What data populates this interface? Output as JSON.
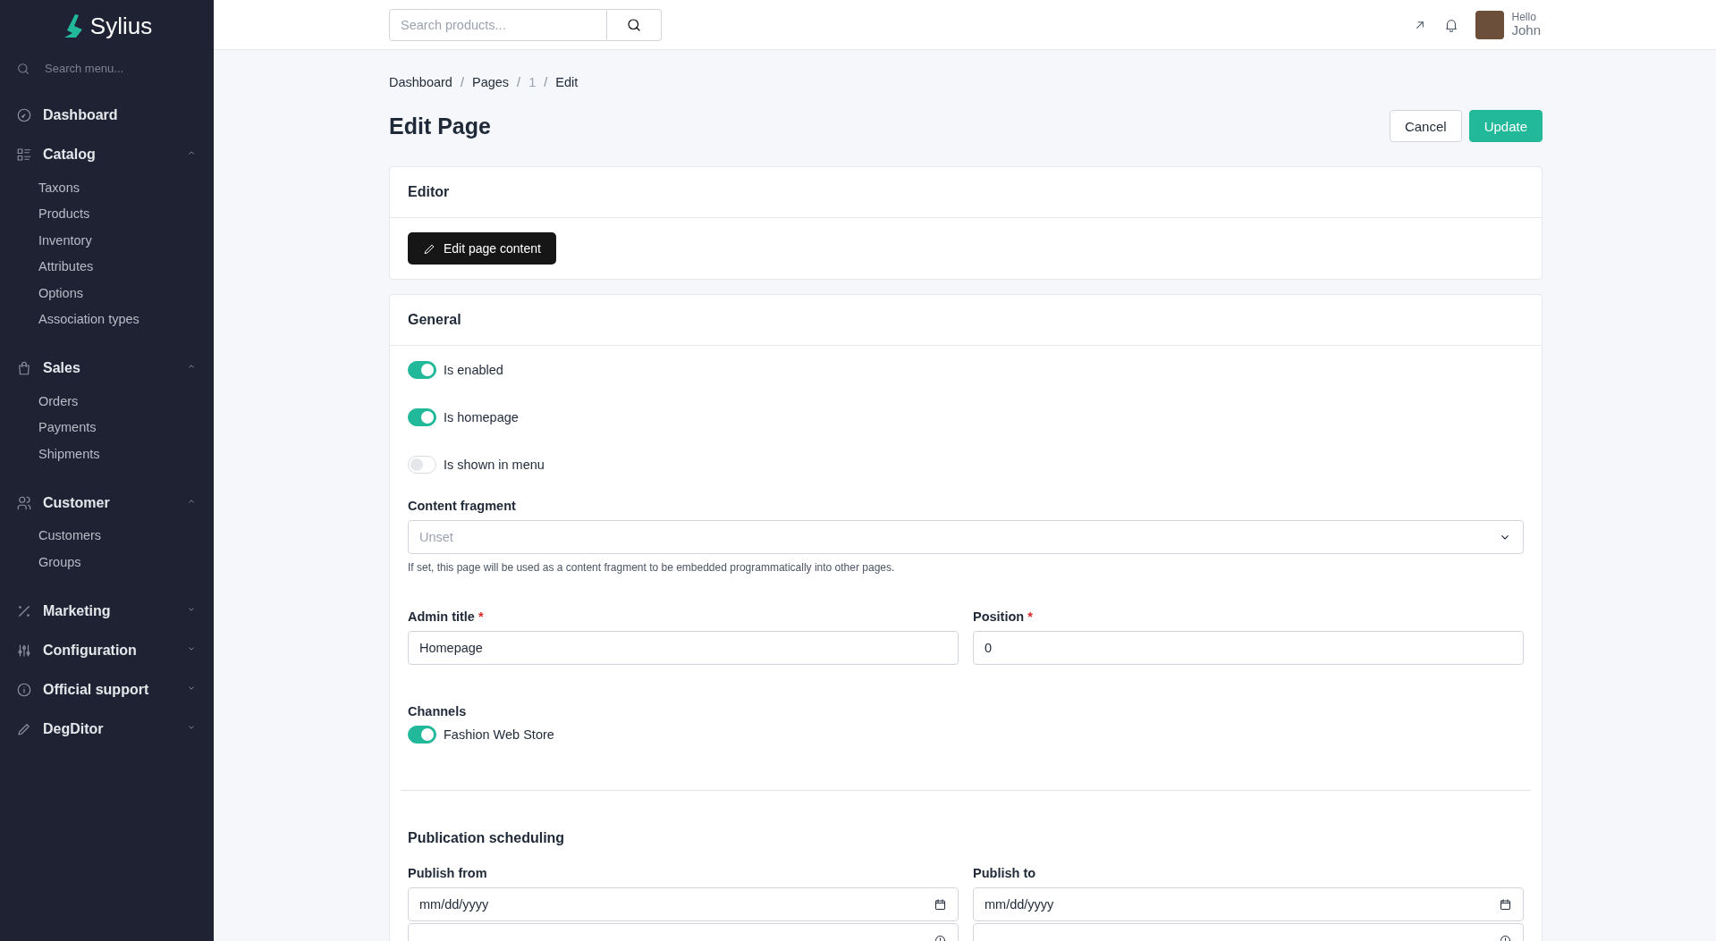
{
  "sidebar": {
    "logo": "Sylius",
    "search": {
      "placeholder": "Search menu..."
    },
    "sections": [
      {
        "label": "Dashboard"
      },
      {
        "label": "Catalog",
        "expanded": true,
        "items": [
          "Taxons",
          "Products",
          "Inventory",
          "Attributes",
          "Options",
          "Association types"
        ]
      },
      {
        "label": "Sales",
        "expanded": true,
        "items": [
          "Orders",
          "Payments",
          "Shipments"
        ]
      },
      {
        "label": "Customer",
        "expanded": true,
        "items": [
          "Customers",
          "Groups"
        ]
      },
      {
        "label": "Marketing",
        "expanded": false
      },
      {
        "label": "Configuration",
        "expanded": false
      },
      {
        "label": "Official support",
        "expanded": false
      },
      {
        "label": "DegDitor",
        "expanded": false
      }
    ]
  },
  "header": {
    "search": {
      "placeholder": "Search products..."
    },
    "user": {
      "greeting": "Hello",
      "name": "John"
    }
  },
  "breadcrumb": [
    {
      "label": "Dashboard",
      "disabled": false
    },
    {
      "separator": "/",
      "label": "Pages",
      "disabled": false
    },
    {
      "separator": "/",
      "label": "1",
      "disabled": true
    },
    {
      "separator": "/",
      "label": "Edit",
      "disabled": false
    }
  ],
  "title": "Edit Page",
  "actions": {
    "cancel": "Cancel",
    "update": "Update"
  },
  "editor": {
    "title": "Editor",
    "button": "Edit page content"
  },
  "general": {
    "title": "General",
    "toggles": [
      {
        "label": "Is enabled",
        "on": true
      },
      {
        "label": "Is homepage",
        "on": true
      },
      {
        "label": "Is shown in menu",
        "on": false
      }
    ],
    "content_fragment": {
      "label": "Content fragment",
      "placeholder": "Unset",
      "help": "If set, this page will be used as a content fragment to be embedded programmatically into other pages."
    },
    "admin_title": {
      "label": "Admin title",
      "required_mark": "*",
      "value": "Homepage"
    },
    "position": {
      "label": "Position",
      "required_mark": "*",
      "value": "0"
    },
    "channels": {
      "label": "Channels",
      "items": [
        {
          "label": "Fashion Web Store",
          "on": true
        }
      ]
    },
    "scheduling": {
      "title": "Publication scheduling",
      "fields": [
        {
          "label": "Publish from",
          "placeholder": "mm/dd/yyyy"
        },
        {
          "label": "Publish to",
          "placeholder": "mm/dd/yyyy"
        }
      ]
    }
  }
}
